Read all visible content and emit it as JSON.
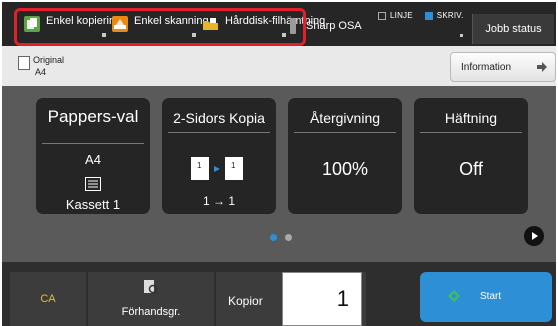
{
  "top_bar": {
    "modes": [
      {
        "label": "Enkel kopiering",
        "icon": "copy-icon",
        "color": "#5aa544"
      },
      {
        "label": "Enkel skanning",
        "icon": "scan-icon",
        "color": "#e98a16"
      },
      {
        "label": "Hårddisk-filhämtning",
        "icon": "folder-icon",
        "color": "#e8b52a"
      },
      {
        "label": "Sharp OSA",
        "icon": "osa-icon",
        "color": "#9a9a9a"
      }
    ],
    "status": {
      "line": "LINJE",
      "print": "SKRIV."
    },
    "job_status_label": "Jobb status",
    "highlight_color": "#e0202a"
  },
  "original": {
    "label": "Original",
    "value": "A4"
  },
  "information_label": "Information",
  "tiles": {
    "paper": {
      "title": "Pappers-val",
      "size": "A4",
      "tray": "Kassett 1",
      "icon": "tray-icon"
    },
    "duplex": {
      "title": "2-Sidors Kopia",
      "value": "1 → 1",
      "icon": "duplex-icon"
    },
    "zoom": {
      "title": "Återgivning",
      "value": "100%"
    },
    "staple": {
      "title": "Häftning",
      "value": "Off"
    }
  },
  "pager": {
    "pages": 2,
    "current": 1
  },
  "bottom_bar": {
    "ca_label": "CA",
    "preview_label": "Förhandsgr.",
    "copies_label": "Kopior",
    "copies_value": "1",
    "start_label": "Start",
    "accent": "#2d8fd6"
  }
}
